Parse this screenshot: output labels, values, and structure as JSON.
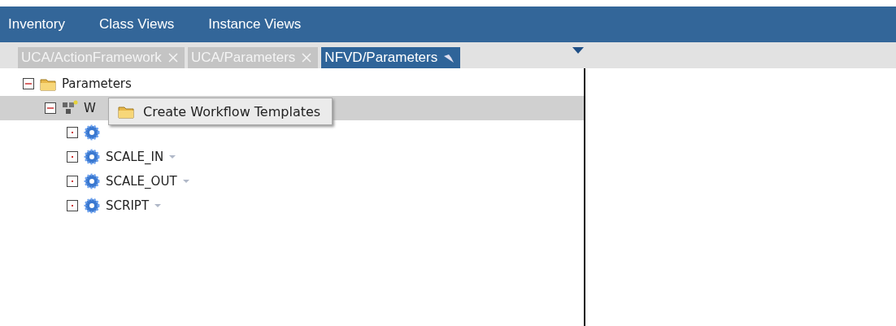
{
  "menu_bar": {
    "items": [
      {
        "label": "Inventory"
      },
      {
        "label": "Class Views"
      },
      {
        "label": "Instance Views"
      }
    ]
  },
  "tabs": [
    {
      "label": "UCA/ActionFramework",
      "selected": false,
      "kind": "closable"
    },
    {
      "label": "UCA/Parameters",
      "selected": false,
      "kind": "closable"
    },
    {
      "label": "NFVD/Parameters",
      "selected": true,
      "kind": "pinned"
    }
  ],
  "tree": [
    {
      "label": "Parameters",
      "kind": "folder",
      "expanded": true,
      "selected": false,
      "children": [
        {
          "label": "W",
          "kind": "workflow",
          "expanded": true,
          "selected": true,
          "children": [
            {
              "kind": "gear",
              "expanded": false,
              "selected": false
            },
            {
              "label": "SCALE_IN",
              "kind": "gear",
              "expanded": false,
              "selected": false
            },
            {
              "label": "SCALE_OUT",
              "kind": "gear",
              "expanded": false,
              "selected": false
            },
            {
              "label": "SCRIPT",
              "kind": "gear",
              "expanded": false,
              "selected": false
            }
          ]
        }
      ]
    }
  ],
  "context_menu": {
    "items": [
      {
        "label": "Create Workflow Templates"
      }
    ]
  }
}
